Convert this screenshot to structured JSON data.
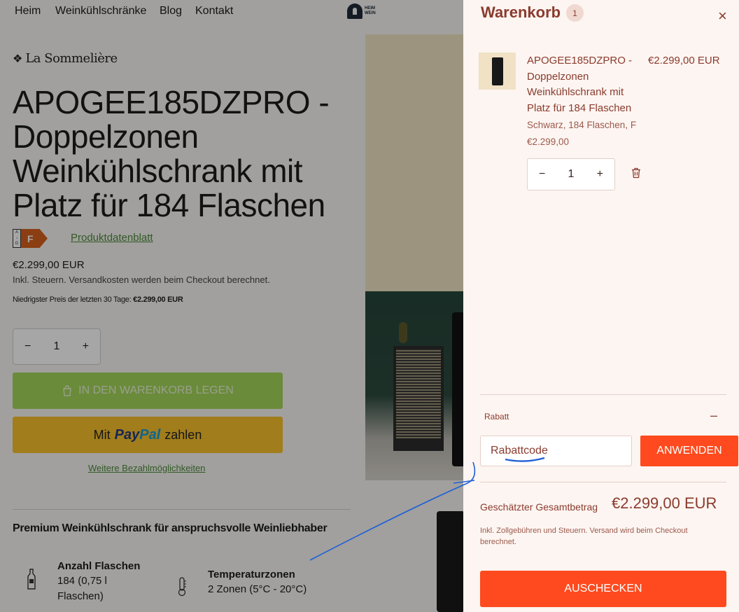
{
  "nav": {
    "items": [
      "Heim",
      "Weinkühlschränke",
      "Blog",
      "Kontakt"
    ],
    "logo_text_line1": "HEIM",
    "logo_text_line2": "WEIN"
  },
  "product": {
    "brand": "La Sommelière",
    "title": "APOGEE185DZPRO - Doppelzonen Weinkühlschrank mit Platz für 184 Flaschen",
    "energy_scale": "A\nG",
    "energy_class": "F",
    "datasheet_link": "Produktdatenblatt",
    "price": "€2.299,00 EUR",
    "tax_note": "Inkl. Steuern. Versandkosten werden beim Checkout berechnet.",
    "lowest_price_label": "Niedrigster Preis der letzten 30 Tage: ",
    "lowest_price_value": "€2.299,00 EUR",
    "quantity": "1",
    "add_to_cart": "IN DEN WARENKORB LEGEN",
    "paypal_prefix": "Mit",
    "paypal_brand_1": "Pay",
    "paypal_brand_2": "Pal",
    "paypal_suffix": "zahlen",
    "more_payment": "Weitere Bezahlmöglichkeiten",
    "section_heading": "Premium Weinkühlschrank für anspruchsvolle Weinliebhaber",
    "features": [
      {
        "title": "Anzahl Flaschen",
        "value": "184 (0,75 l Flaschen)",
        "icon": "bottle-icon"
      },
      {
        "title": "Temperaturzonen",
        "value": "2 Zonen (5°C - 20°C)",
        "icon": "thermometer-icon"
      }
    ]
  },
  "cart": {
    "title": "Warenkorb",
    "count": "1",
    "item": {
      "title": "APOGEE185DZPRO - Doppelzonen Weinkühlschrank mit Platz für 184 Flaschen",
      "price": "€2.299,00 EUR",
      "variant": "Schwarz, 184 Flaschen, F",
      "unit_price": "€2.299,00",
      "quantity": "1"
    },
    "discount_label": "Rabatt",
    "discount_toggle": "–",
    "discount_placeholder": "Rabattcode",
    "apply_button": "ANWENDEN",
    "total_label": "Geschätzter Gesamtbetrag",
    "total_value": "€2.299,00 EUR",
    "total_note": "Inkl. Zollgebühren und Steuern. Versand wird beim Checkout berechnet.",
    "checkout_button": "AUSCHECKEN"
  },
  "symbols": {
    "minus": "−",
    "plus": "+",
    "close": "×"
  },
  "colors": {
    "accent": "#fe4a1e",
    "cart_text": "#8a3b2e",
    "add_to_cart_bg": "#a4d65a",
    "paypal_bg": "#f7c12c",
    "annotation": "#1f5fd6"
  }
}
